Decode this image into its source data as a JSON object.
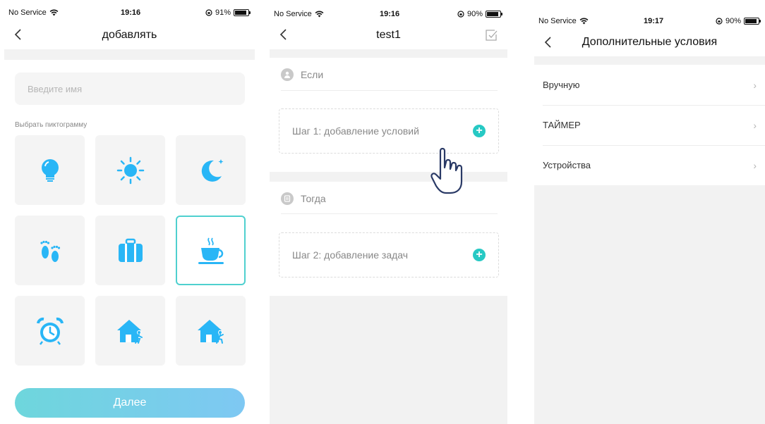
{
  "screen1": {
    "status": {
      "carrier": "No Service",
      "time": "19:16",
      "battery": "91%"
    },
    "title": "добавлять",
    "name_placeholder": "Введите имя",
    "icon_section_label": "Выбрать пиктограмму",
    "icons": [
      "lightbulb-icon",
      "sun-icon",
      "moon-icon",
      "footprints-icon",
      "suitcase-icon",
      "coffee-cup-icon",
      "alarm-clock-icon",
      "home-enter-icon",
      "home-leave-icon"
    ],
    "selected_icon": "coffee-cup-icon",
    "next_label": "Далее",
    "colors": {
      "accent": "#29b6f6",
      "selected_border": "#4fd0cf",
      "button_from": "#6ed6dc",
      "button_to": "#7ec8f3"
    }
  },
  "screen2": {
    "status": {
      "carrier": "No Service",
      "time": "19:16",
      "battery": "90%"
    },
    "title": "test1",
    "if_label": "Если",
    "step1_label": "Шаг 1: добавление условий",
    "then_label": "Тогда",
    "step2_label": "Шаг 2: добавление задач",
    "colors": {
      "plus": "#27c9c4"
    }
  },
  "screen3": {
    "status": {
      "carrier": "No Service",
      "time": "19:17",
      "battery": "90%"
    },
    "title": "Дополнительные условия",
    "rows": [
      "Вручную",
      "ТАЙМЕР",
      "Устройства"
    ]
  }
}
